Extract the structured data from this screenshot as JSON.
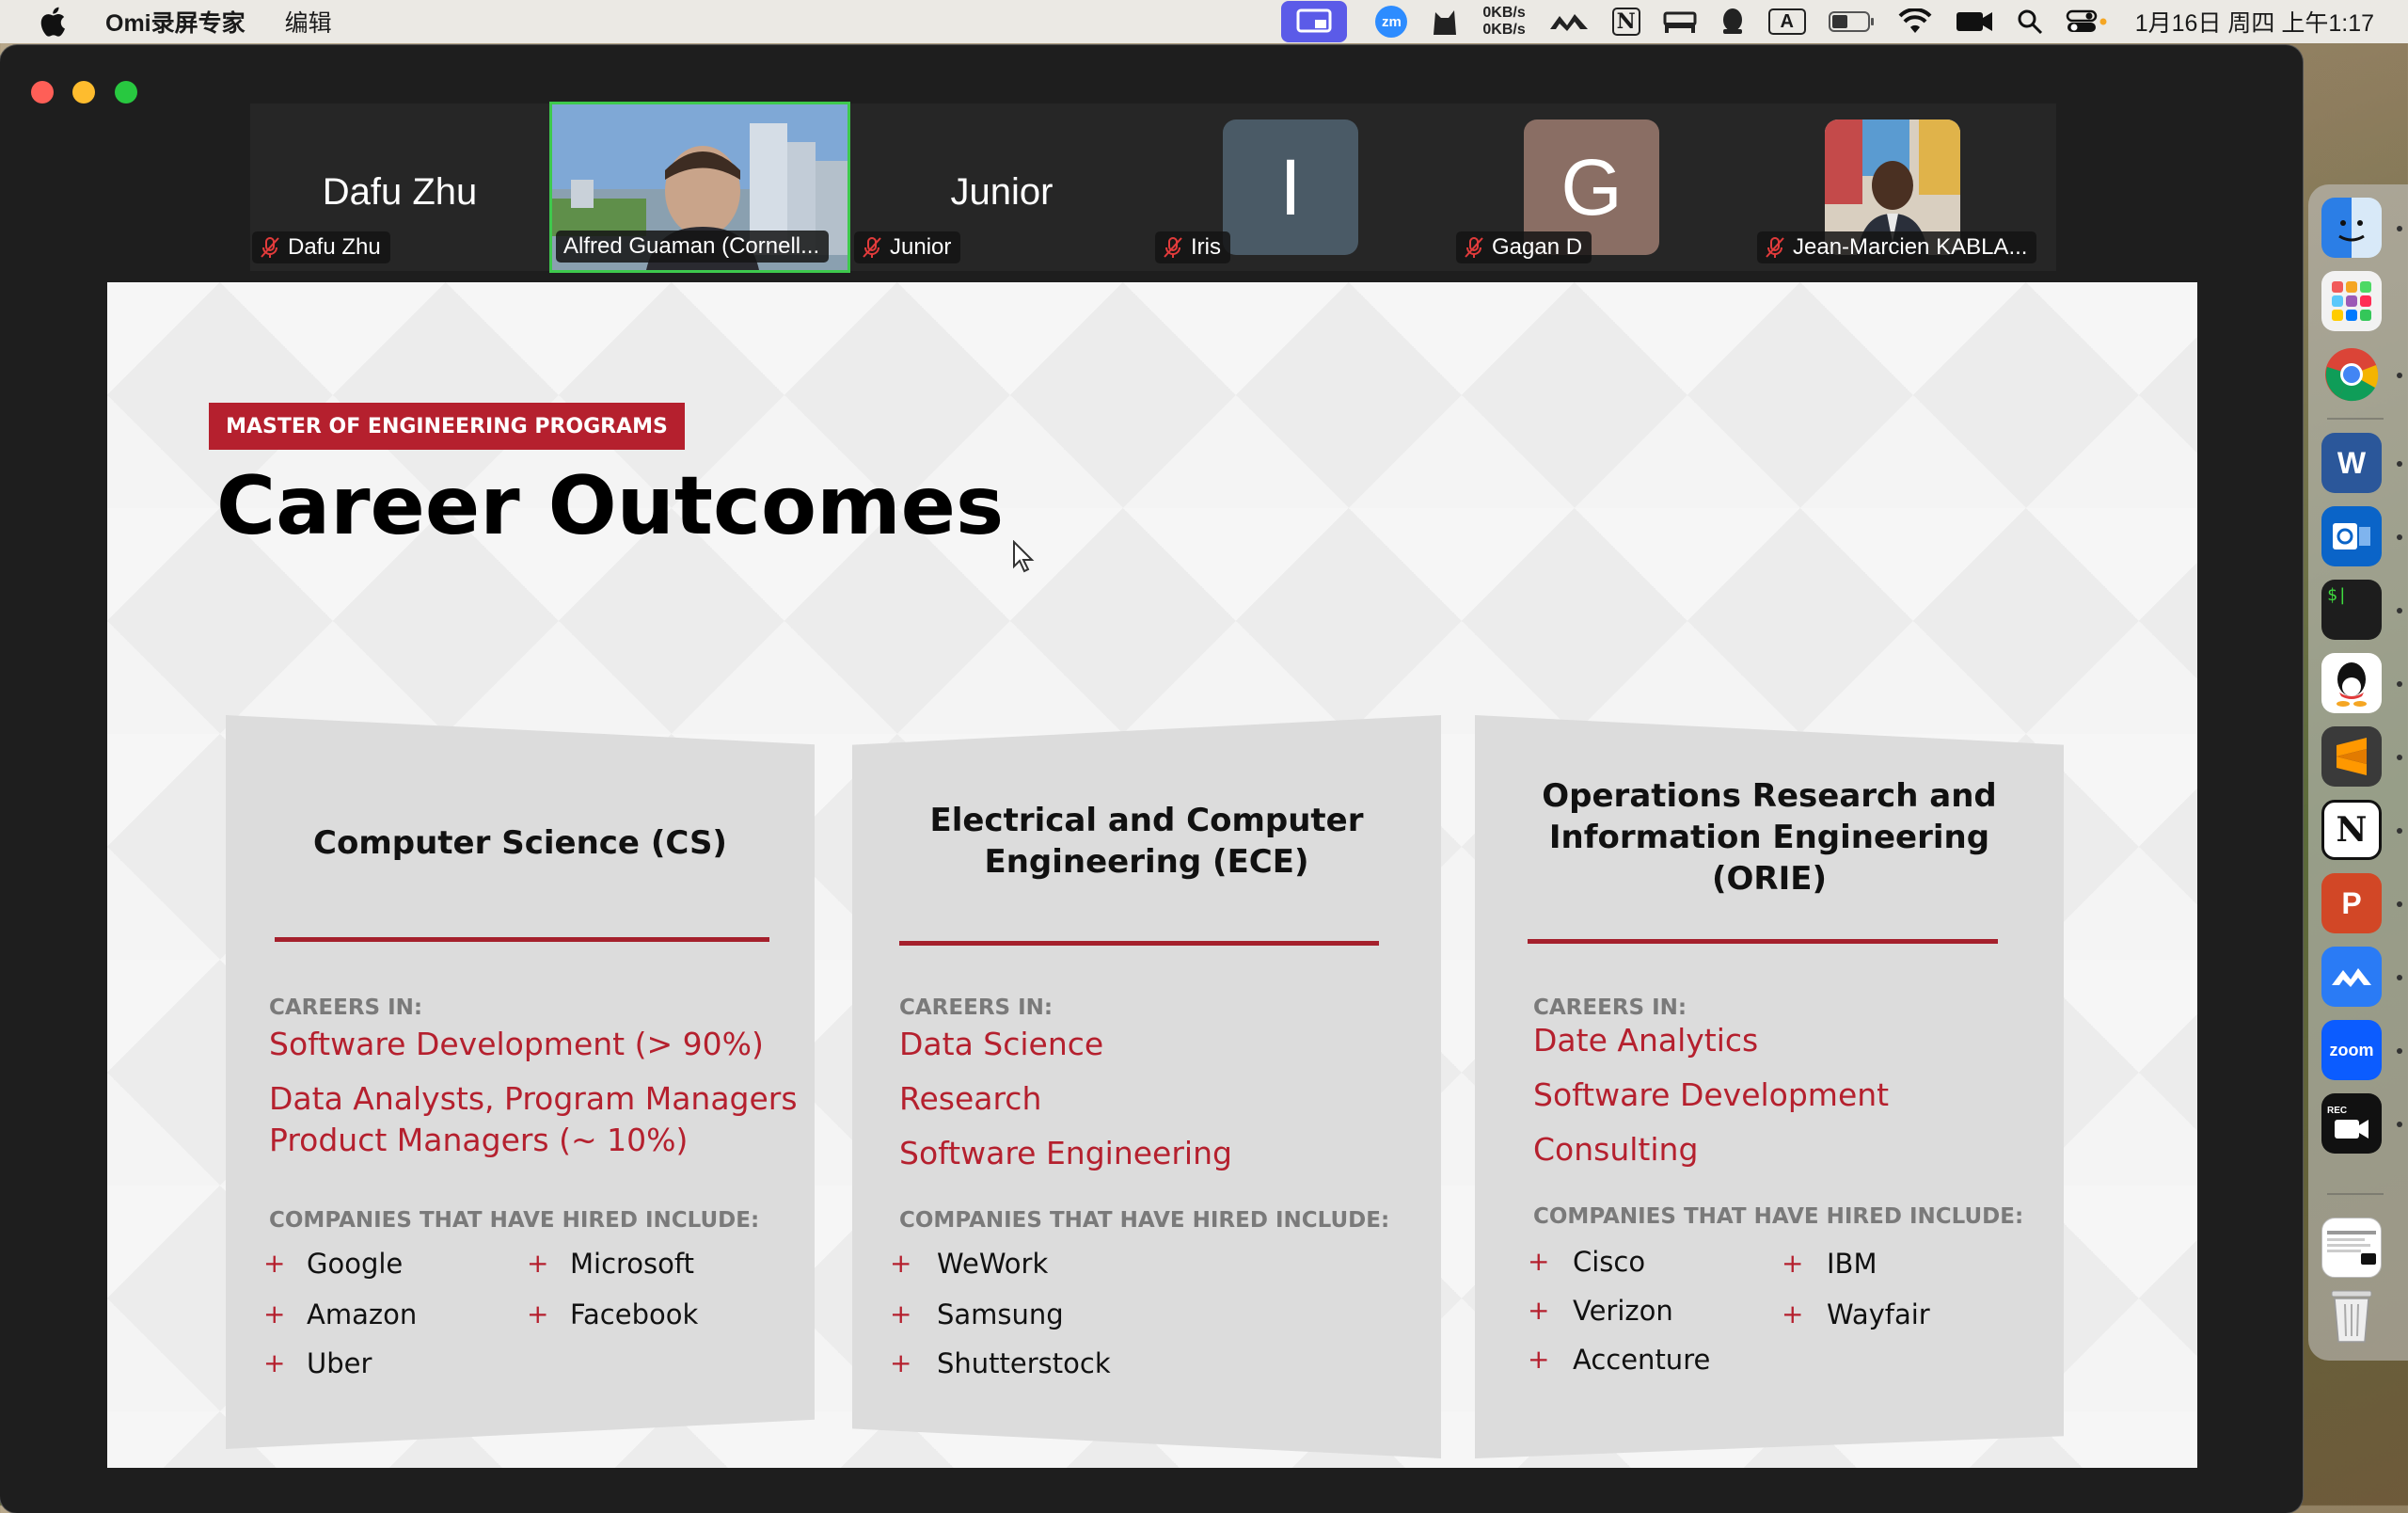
{
  "menubar": {
    "app_name": "Omi录屏专家",
    "edit_menu": "编辑",
    "net_up": "0KB/s",
    "net_down": "0KB/s",
    "zoom_label": "zm",
    "input_method": "A",
    "notion_letter": "N",
    "clock": "1月16日 周四  上午1:17"
  },
  "participants": [
    {
      "display": "Dafu Zhu",
      "label": "Dafu Zhu",
      "muted": true
    },
    {
      "display": "",
      "label": "Alfred Guaman (Cornell...",
      "muted": false,
      "active": true
    },
    {
      "display": "Junior",
      "label": "Junior",
      "muted": true
    },
    {
      "display": "I",
      "label": "Iris",
      "muted": true,
      "avatar_color": "#4a5a66"
    },
    {
      "display": "G",
      "label": "Gagan D",
      "muted": true,
      "avatar_color": "#8a6e64"
    },
    {
      "display": "",
      "label": "Jean-Marcien KABLA...",
      "muted": true
    }
  ],
  "slide": {
    "badge": "MASTER OF ENGINEERING PROGRAMS",
    "title": "Career Outcomes",
    "careers_heading": "CAREERS IN:",
    "companies_heading": "COMPANIES THAT HAVE HIRED INCLUDE:",
    "cs": {
      "title": "Computer Science (CS)",
      "careers": [
        "Software Development (> 90%)",
        "Data Analysts, Program Managers",
        "Product Managers (~ 10%)"
      ],
      "companies": [
        "Google",
        "Microsoft",
        "Amazon",
        "Facebook",
        "Uber"
      ]
    },
    "ece": {
      "title_line1": "Electrical and Computer",
      "title_line2": "Engineering (ECE)",
      "careers": [
        "Data Science",
        "Research",
        "Software Engineering"
      ],
      "companies": [
        "WeWork",
        "Samsung",
        "Shutterstock"
      ]
    },
    "orie": {
      "title_line1": "Operations Research and",
      "title_line2": "Information Engineering",
      "title_line3": "(ORIE)",
      "careers": [
        "Date Analytics",
        "Software Development",
        "Consulting"
      ],
      "companies": [
        "Cisco",
        "IBM",
        "Verizon",
        "Wayfair",
        "Accenture"
      ]
    },
    "plus_symbol": "+"
  },
  "dock": {
    "apps": [
      "finder-icon",
      "launchpad-icon",
      "chrome-icon",
      "word-icon",
      "outlook-icon",
      "terminal-icon",
      "qq-icon",
      "sublime-icon",
      "notion-icon",
      "powerpoint-icon",
      "lark-icon",
      "zoom-icon",
      "recorder-icon",
      "preview-icon",
      "trash-icon"
    ],
    "terminal_text": "$|",
    "zoom_text": "zoom",
    "rec_text": "REC",
    "word_letter": "W",
    "notion_letter": "N",
    "ppt_letter": "P"
  }
}
